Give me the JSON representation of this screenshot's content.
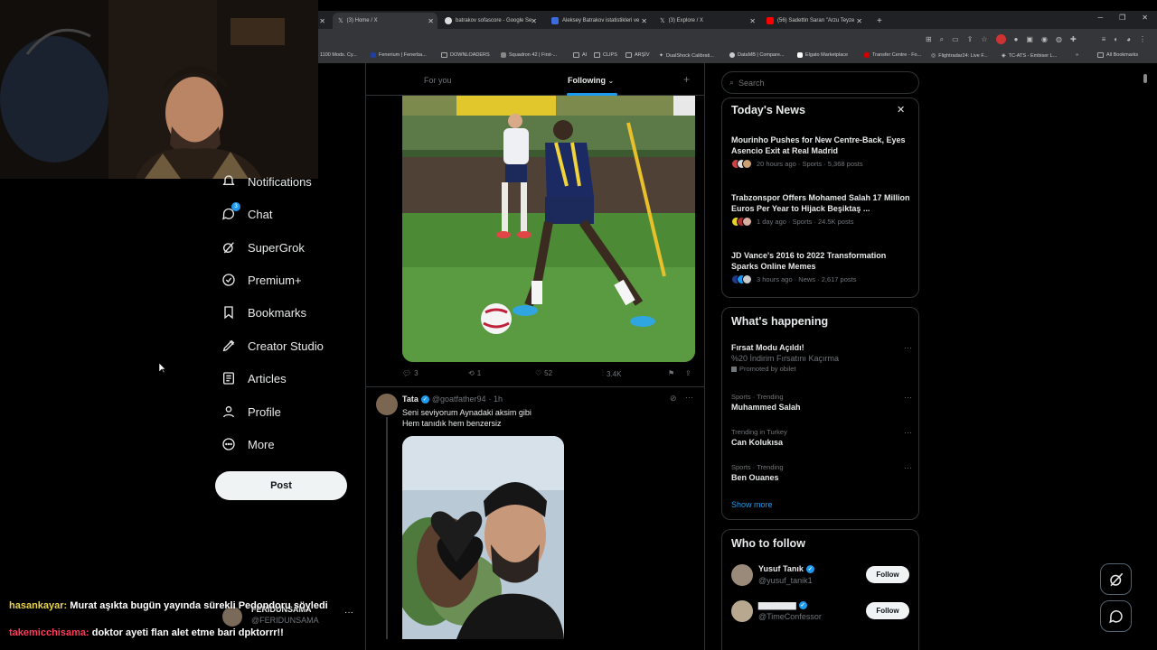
{
  "browser": {
    "tabs": [
      {
        "title": "(3) Home / X"
      },
      {
        "title": "batrakov sofascore - Google Se"
      },
      {
        "title": "Aleksey Batrakov istatistikleri ve"
      },
      {
        "title": "(3) Explore / X"
      },
      {
        "title": "(56) Sadettin Saran \"Arzu Teyze"
      }
    ],
    "bookmarks": [
      "1100 Mods. Cy...",
      "Fenerium | Fenerba...",
      "DOWNLOADERS",
      "Squadron 42 | First-...",
      "AI",
      "CLIPS",
      "ARŞİV",
      "DualShock Calibrati...",
      "DataMB | Compare...",
      "Elgato Marketplace",
      "Transfer Centre - Fo...",
      "Flightradar24: Live F...",
      "TC-ATS - Embiser L...",
      "All Bookmarks"
    ]
  },
  "nav": {
    "items": [
      {
        "label": "Notifications",
        "icon": "bell-icon"
      },
      {
        "label": "Chat",
        "icon": "chat-icon",
        "badge": "3"
      },
      {
        "label": "SuperGrok",
        "icon": "grok-icon"
      },
      {
        "label": "Premium+",
        "icon": "premium-icon"
      },
      {
        "label": "Bookmarks",
        "icon": "bookmark-icon"
      },
      {
        "label": "Creator Studio",
        "icon": "creator-studio-icon"
      },
      {
        "label": "Articles",
        "icon": "articles-icon"
      },
      {
        "label": "Profile",
        "icon": "profile-icon"
      },
      {
        "label": "More",
        "icon": "more-circle-icon"
      }
    ],
    "post_label": "Post",
    "account": {
      "name": "FERİDUNSAMA",
      "handle": "@FERIDUNSAMA"
    }
  },
  "chat_overlay": [
    {
      "user": "hasankayar:",
      "message": "Murat aşıkta bugün yayında sürekli Pedondoru söyledi",
      "color": "#e8d44d"
    },
    {
      "user": "takemicchisama:",
      "message": "doktor ayeti flan alet etme bari dpktorrr!!",
      "color": "#ff3b5c"
    }
  ],
  "feed": {
    "tabs": [
      {
        "label": "For you"
      },
      {
        "label": "Following"
      }
    ],
    "add_label": "+",
    "post1": {
      "replies": "3",
      "reposts": "1",
      "likes": "52",
      "views": "3.4K"
    },
    "post2": {
      "name": "Tata",
      "handle": "@goatfather94",
      "time": "· 1h",
      "lines": [
        "Seni seviyorum Aynadaki aksim gibi",
        "Hem tanıdık hem benzersiz"
      ]
    }
  },
  "search": {
    "placeholder": "Search"
  },
  "news": {
    "title": "Today's News",
    "items": [
      {
        "title": "Mourinho Pushes for New Centre-Back, Eyes Asencio Exit at Real Madrid",
        "meta": "20 hours ago · Sports · 5,368 posts"
      },
      {
        "title": "Trabzonspor Offers Mohamed Salah 17 Million Euros Per Year to Hijack Beşiktaş ...",
        "meta": "1 day ago · Sports · 24.5K posts"
      },
      {
        "title": "JD Vance's 2016 to 2022 Transformation Sparks Online Memes",
        "meta": "3 hours ago · News · 2,617 posts"
      }
    ]
  },
  "happening": {
    "title": "What's happening",
    "promo": {
      "title": "Fırsat Modu Açıldı!",
      "subtitle": "%20 İndirim Fırsatını Kaçırma",
      "promoted": "Promoted by obilet"
    },
    "trends": [
      {
        "category": "Sports · Trending",
        "name": "Muhammed Salah"
      },
      {
        "category": "Trending in Turkey",
        "name": "Can Kolukısa"
      },
      {
        "category": "Sports · Trending",
        "name": "Ben Ouanes"
      }
    ],
    "show_more": "Show more"
  },
  "who_to_follow": {
    "title": "Who to follow",
    "accounts": [
      {
        "name": "Yusuf Tanık",
        "handle": "@yusuf_tanik1",
        "button": "Follow"
      },
      {
        "name": "▆▆▆▆▆▆",
        "handle": "@TimeConfessor",
        "button": "Follow"
      }
    ]
  },
  "colors": {
    "accent": "#1d9bf0",
    "bg": "#000000",
    "border": "#2f3336",
    "muted": "#71767b"
  }
}
